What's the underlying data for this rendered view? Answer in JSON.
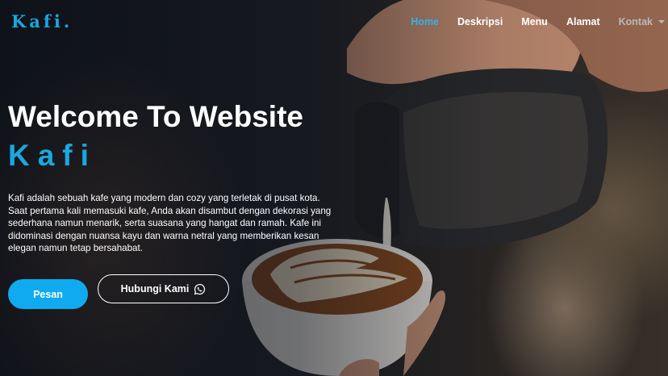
{
  "brand": {
    "logo_text": "Kafi."
  },
  "nav": {
    "items": [
      {
        "label": "Home",
        "active": true
      },
      {
        "label": "Deskripsi"
      },
      {
        "label": "Menu"
      },
      {
        "label": "Alamat"
      }
    ],
    "dropdown_label": "Kontak"
  },
  "hero": {
    "title_line1": "Welcome To Website",
    "title_line2": "Kafi",
    "description": "Kafi adalah sebuah kafe yang modern dan cozy yang terletak di pusat kota. Saat pertama kali memasuki kafe, Anda akan disambut dengan dekorasi yang sederhana namun menarik, serta suasana yang hangat dan ramah. Kafe ini didominasi dengan nuansa kayu dan warna netral yang memberikan kesan elegan namun tetap bersahabat.",
    "primary_button_label": "Pesan",
    "secondary_button_label": "Hubungi Kami",
    "secondary_button_icon": "whatsapp-icon"
  },
  "colors": {
    "accent": "#1aa7e0",
    "primary_button": "#10aaf0",
    "nav_active": "#2fb3ea"
  }
}
